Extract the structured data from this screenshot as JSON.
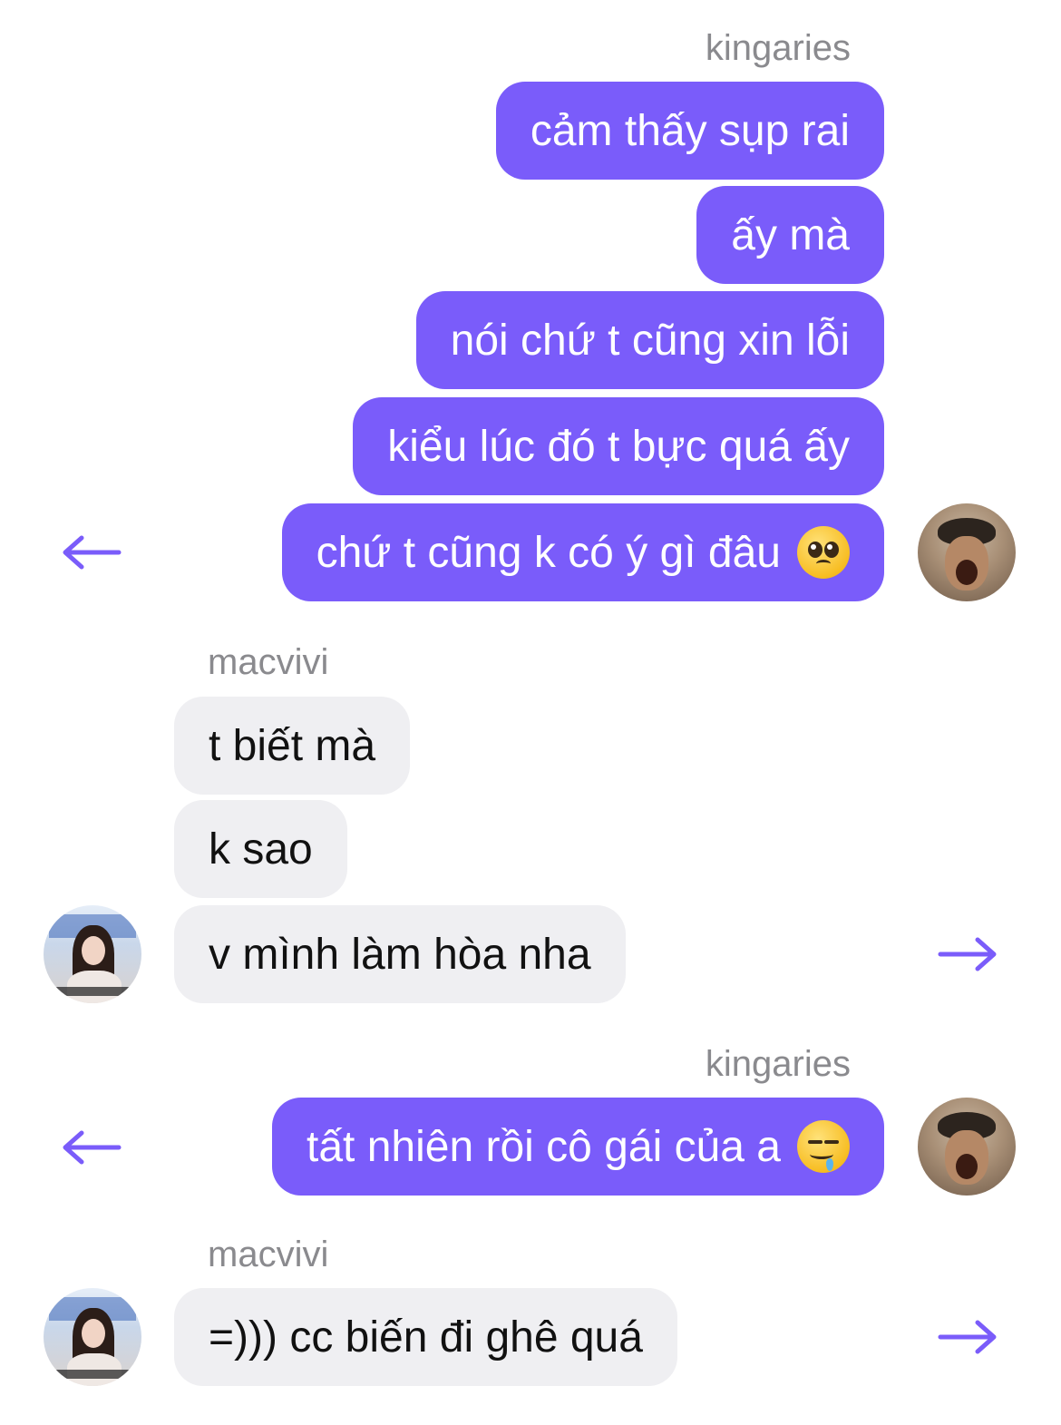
{
  "accent_color": "#7a5cfa",
  "incoming_bubble_color": "#efeff2",
  "sender_me": "kingaries",
  "sender_other": "macvivi",
  "messages": {
    "m1": "cảm thấy sụp rai",
    "m2": "ấy mà",
    "m3": "nói chứ t cũng xin lỗi",
    "m4": "kiểu lúc đó t bực quá ấy",
    "m5": "chứ t cũng k có ý gì đâu",
    "m6": "t biết mà",
    "m7": "k sao",
    "m8": "v mình làm hòa nha",
    "m9": "tất nhiên rồi cô gái của a",
    "m10": "=))) cc biến đi ghê quá"
  },
  "icons": {
    "reply": "arrow-left-icon",
    "forward": "arrow-right-icon",
    "pleading": "pleading-face-emoji",
    "drooling": "drooling-face-emoji"
  }
}
